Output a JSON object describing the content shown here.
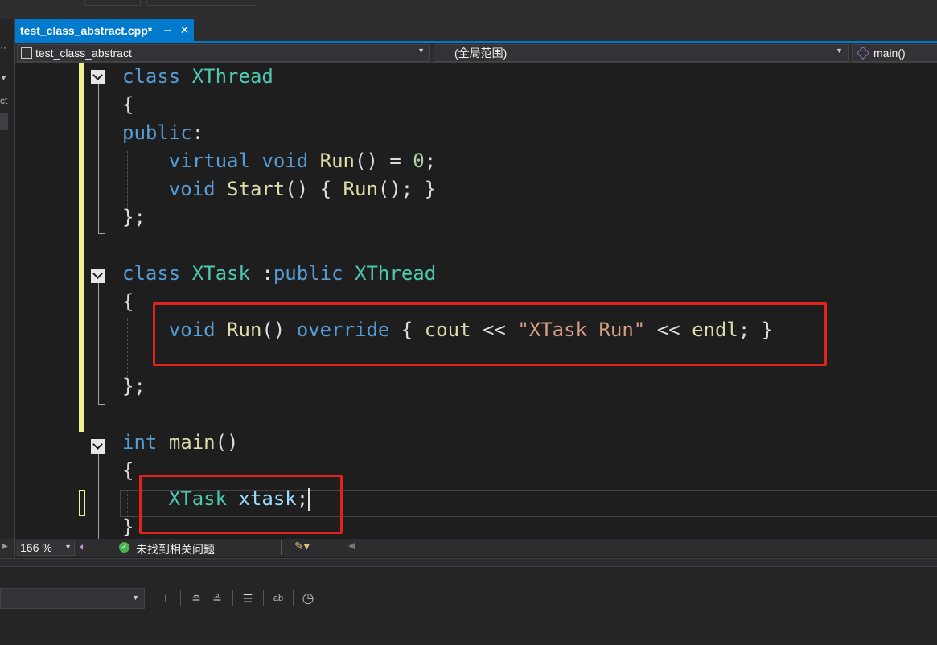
{
  "tab": {
    "title": "test_class_abstract.cpp*",
    "pin_icon": "pin-icon",
    "close_glyph": "✕"
  },
  "navigation": {
    "project": "test_class_abstract",
    "scope": "(全局范围)",
    "member": "main()"
  },
  "left_panel": {
    "fragment_1": "ct"
  },
  "editor": {
    "lines": [
      [
        [
          "kw",
          "class"
        ],
        [
          "pl",
          " "
        ],
        [
          "ty",
          "XThread"
        ]
      ],
      [
        [
          "pl",
          "{"
        ]
      ],
      [
        [
          "kw",
          "public"
        ],
        [
          "pl",
          ":"
        ]
      ],
      [
        [
          "pl",
          "    "
        ],
        [
          "kw",
          "virtual"
        ],
        [
          "pl",
          " "
        ],
        [
          "kw",
          "void"
        ],
        [
          "pl",
          " "
        ],
        [
          "fn",
          "Run"
        ],
        [
          "pl",
          "() = "
        ],
        [
          "num",
          "0"
        ],
        [
          "pl",
          ";"
        ]
      ],
      [
        [
          "pl",
          "    "
        ],
        [
          "kw",
          "void"
        ],
        [
          "pl",
          " "
        ],
        [
          "fn",
          "Start"
        ],
        [
          "pl",
          "() { "
        ],
        [
          "fn",
          "Run"
        ],
        [
          "pl",
          "(); }"
        ]
      ],
      [
        [
          "pl",
          "};"
        ]
      ],
      [
        [
          "pl",
          ""
        ]
      ],
      [
        [
          "kw",
          "class"
        ],
        [
          "pl",
          " "
        ],
        [
          "ty",
          "XTask"
        ],
        [
          "pl",
          " :"
        ],
        [
          "kw",
          "public"
        ],
        [
          "pl",
          " "
        ],
        [
          "ty",
          "XThread"
        ]
      ],
      [
        [
          "pl",
          "{"
        ]
      ],
      [
        [
          "pl",
          "    "
        ],
        [
          "kw",
          "void"
        ],
        [
          "pl",
          " "
        ],
        [
          "fn",
          "Run"
        ],
        [
          "pl",
          "() "
        ],
        [
          "kw",
          "override"
        ],
        [
          "pl",
          " { "
        ],
        [
          "fn",
          "cout"
        ],
        [
          "pl",
          " << "
        ],
        [
          "str",
          "\"XTask Run\""
        ],
        [
          "pl",
          " << "
        ],
        [
          "fn",
          "endl"
        ],
        [
          "pl",
          "; }"
        ]
      ],
      [
        [
          "pl",
          ""
        ]
      ],
      [
        [
          "pl",
          "};"
        ]
      ],
      [
        [
          "pl",
          ""
        ]
      ],
      [
        [
          "kw",
          "int"
        ],
        [
          "pl",
          " "
        ],
        [
          "fn",
          "main"
        ],
        [
          "pl",
          "()"
        ]
      ],
      [
        [
          "pl",
          "{"
        ]
      ],
      [
        [
          "pl",
          "    "
        ],
        [
          "ty",
          "XTask"
        ],
        [
          "pl",
          " "
        ],
        [
          "var",
          "xtask"
        ],
        [
          "pl",
          ";"
        ]
      ],
      [
        [
          "pl",
          "}"
        ]
      ]
    ]
  },
  "status": {
    "zoom": "166 %",
    "issues": "未找到相关问题"
  },
  "colors": {
    "accent": "#007acc",
    "highlight_box": "#e3221c",
    "keyword": "#569cd6",
    "type": "#4ec9b0",
    "function": "#dcdcaa",
    "string": "#d69d85",
    "number": "#b5cea8",
    "variable": "#9cdcfe",
    "change_bar": "#efef91"
  }
}
